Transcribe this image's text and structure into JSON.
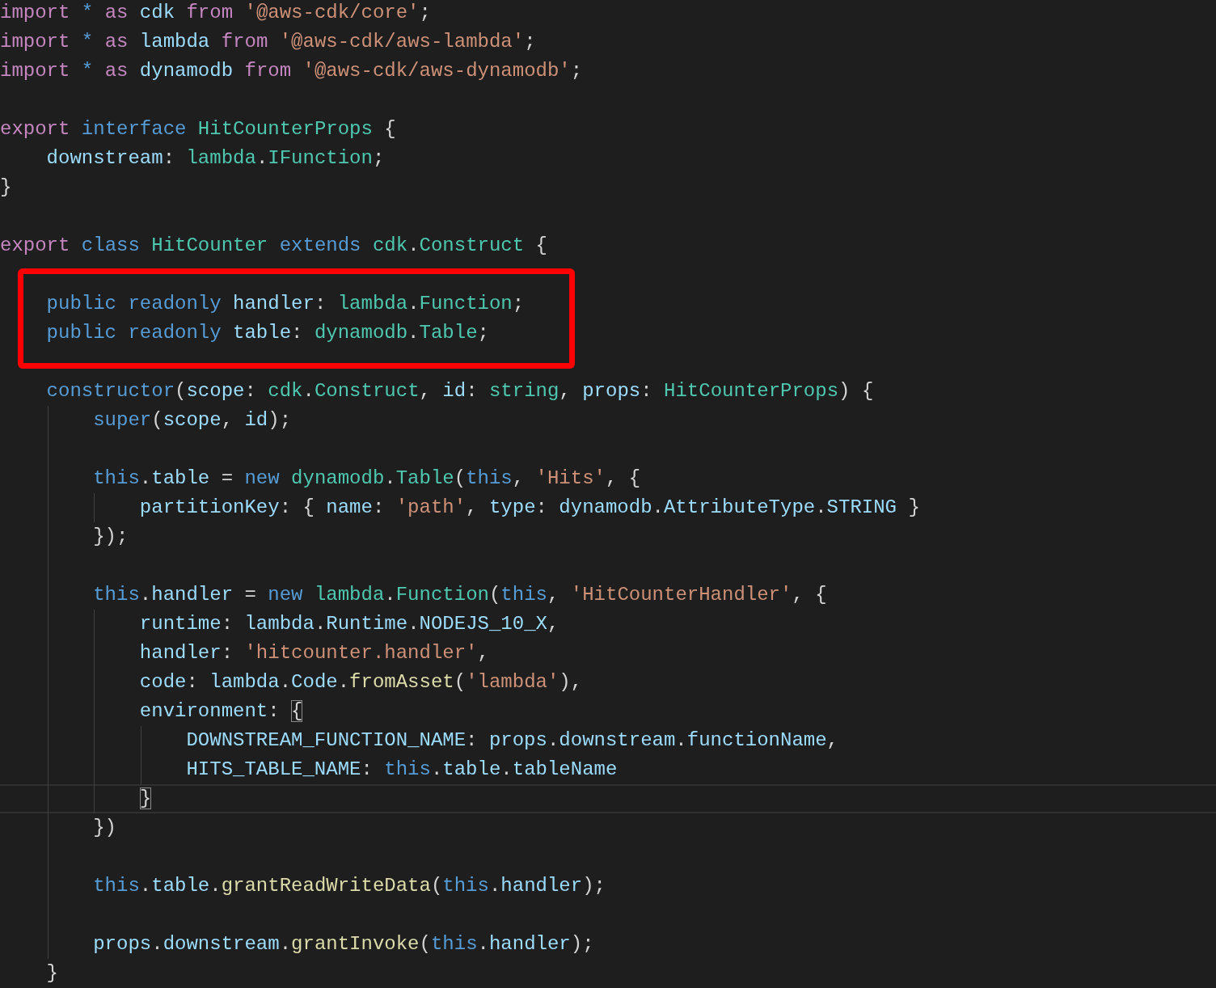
{
  "editor": {
    "lines": [
      {
        "current": false,
        "boxed": false,
        "tokens": [
          {
            "text": "import ",
            "kind": "keyword"
          },
          {
            "text": "* ",
            "kind": "storage"
          },
          {
            "text": "as ",
            "kind": "keyword"
          },
          {
            "text": "cdk ",
            "kind": "variable"
          },
          {
            "text": "from ",
            "kind": "keyword"
          },
          {
            "text": "'@aws-cdk/core'",
            "kind": "string"
          },
          {
            "text": ";",
            "kind": "punct"
          }
        ]
      },
      {
        "current": false,
        "boxed": false,
        "tokens": [
          {
            "text": "import ",
            "kind": "keyword"
          },
          {
            "text": "* ",
            "kind": "storage"
          },
          {
            "text": "as ",
            "kind": "keyword"
          },
          {
            "text": "lambda ",
            "kind": "variable"
          },
          {
            "text": "from ",
            "kind": "keyword"
          },
          {
            "text": "'@aws-cdk/aws-lambda'",
            "kind": "string"
          },
          {
            "text": ";",
            "kind": "punct"
          }
        ]
      },
      {
        "current": false,
        "boxed": false,
        "tokens": [
          {
            "text": "import ",
            "kind": "keyword"
          },
          {
            "text": "* ",
            "kind": "storage"
          },
          {
            "text": "as ",
            "kind": "keyword"
          },
          {
            "text": "dynamodb ",
            "kind": "variable"
          },
          {
            "text": "from ",
            "kind": "keyword"
          },
          {
            "text": "'@aws-cdk/aws-dynamodb'",
            "kind": "string"
          },
          {
            "text": ";",
            "kind": "punct"
          }
        ]
      },
      {
        "current": false,
        "boxed": false
      },
      {
        "current": false,
        "boxed": false,
        "tokens": [
          {
            "text": "export ",
            "kind": "keyword"
          },
          {
            "text": "interface ",
            "kind": "storage"
          },
          {
            "text": "HitCounterProps ",
            "kind": "type"
          },
          {
            "text": "{",
            "kind": "punct"
          }
        ]
      },
      {
        "current": false,
        "boxed": false,
        "tokens": [
          {
            "text": "    downstream",
            "kind": "variable"
          },
          {
            "text": ": ",
            "kind": "punct"
          },
          {
            "text": "lambda",
            "kind": "type"
          },
          {
            "text": ".",
            "kind": "punct"
          },
          {
            "text": "IFunction",
            "kind": "type"
          },
          {
            "text": ";",
            "kind": "punct"
          }
        ]
      },
      {
        "current": false,
        "boxed": false,
        "tokens": [
          {
            "text": "}",
            "kind": "punct"
          }
        ]
      },
      {
        "current": false,
        "boxed": false
      },
      {
        "current": false,
        "boxed": false,
        "tokens": [
          {
            "text": "export ",
            "kind": "keyword"
          },
          {
            "text": "class ",
            "kind": "storage"
          },
          {
            "text": "HitCounter ",
            "kind": "type"
          },
          {
            "text": "extends ",
            "kind": "storage"
          },
          {
            "text": "cdk",
            "kind": "type"
          },
          {
            "text": ".",
            "kind": "punct"
          },
          {
            "text": "Construct ",
            "kind": "type"
          },
          {
            "text": "{",
            "kind": "punct"
          }
        ]
      },
      {
        "current": false,
        "boxed": false
      },
      {
        "current": false,
        "boxed": true,
        "tokens": [
          {
            "text": "    public ",
            "kind": "storage"
          },
          {
            "text": "readonly ",
            "kind": "storage"
          },
          {
            "text": "handler",
            "kind": "variable"
          },
          {
            "text": ": ",
            "kind": "punct"
          },
          {
            "text": "lambda",
            "kind": "type"
          },
          {
            "text": ".",
            "kind": "punct"
          },
          {
            "text": "Function",
            "kind": "type"
          },
          {
            "text": ";",
            "kind": "punct"
          }
        ]
      },
      {
        "current": false,
        "boxed": true,
        "tokens": [
          {
            "text": "    public ",
            "kind": "storage"
          },
          {
            "text": "readonly ",
            "kind": "storage"
          },
          {
            "text": "table",
            "kind": "variable"
          },
          {
            "text": ": ",
            "kind": "punct"
          },
          {
            "text": "dynamodb",
            "kind": "type"
          },
          {
            "text": ".",
            "kind": "punct"
          },
          {
            "text": "Table",
            "kind": "type"
          },
          {
            "text": ";",
            "kind": "punct"
          }
        ]
      },
      {
        "current": false,
        "boxed": false
      },
      {
        "current": false,
        "boxed": false,
        "tokens": [
          {
            "text": "    constructor",
            "kind": "storage"
          },
          {
            "text": "(",
            "kind": "punct"
          },
          {
            "text": "scope",
            "kind": "variable"
          },
          {
            "text": ": ",
            "kind": "punct"
          },
          {
            "text": "cdk",
            "kind": "type"
          },
          {
            "text": ".",
            "kind": "punct"
          },
          {
            "text": "Construct",
            "kind": "type"
          },
          {
            "text": ", ",
            "kind": "punct"
          },
          {
            "text": "id",
            "kind": "variable"
          },
          {
            "text": ": ",
            "kind": "punct"
          },
          {
            "text": "string",
            "kind": "type"
          },
          {
            "text": ", ",
            "kind": "punct"
          },
          {
            "text": "props",
            "kind": "variable"
          },
          {
            "text": ": ",
            "kind": "punct"
          },
          {
            "text": "HitCounterProps",
            "kind": "type"
          },
          {
            "text": ") {",
            "kind": "punct"
          }
        ]
      },
      {
        "current": false,
        "boxed": false,
        "tokens": [
          {
            "text": "        super",
            "kind": "storage"
          },
          {
            "text": "(",
            "kind": "punct"
          },
          {
            "text": "scope",
            "kind": "variable"
          },
          {
            "text": ", ",
            "kind": "punct"
          },
          {
            "text": "id",
            "kind": "variable"
          },
          {
            "text": ");",
            "kind": "punct"
          }
        ]
      },
      {
        "current": false,
        "boxed": false
      },
      {
        "current": false,
        "boxed": false,
        "tokens": [
          {
            "text": "        this",
            "kind": "storage"
          },
          {
            "text": ".",
            "kind": "punct"
          },
          {
            "text": "table",
            "kind": "variable"
          },
          {
            "text": " = ",
            "kind": "punct"
          },
          {
            "text": "new ",
            "kind": "storage"
          },
          {
            "text": "dynamodb",
            "kind": "type"
          },
          {
            "text": ".",
            "kind": "punct"
          },
          {
            "text": "Table",
            "kind": "type"
          },
          {
            "text": "(",
            "kind": "punct"
          },
          {
            "text": "this",
            "kind": "storage"
          },
          {
            "text": ", ",
            "kind": "punct"
          },
          {
            "text": "'Hits'",
            "kind": "string"
          },
          {
            "text": ", {",
            "kind": "punct"
          }
        ]
      },
      {
        "current": false,
        "boxed": false,
        "tokens": [
          {
            "text": "            partitionKey",
            "kind": "variable"
          },
          {
            "text": ": { ",
            "kind": "punct"
          },
          {
            "text": "name",
            "kind": "variable"
          },
          {
            "text": ": ",
            "kind": "punct"
          },
          {
            "text": "'path'",
            "kind": "string"
          },
          {
            "text": ", ",
            "kind": "punct"
          },
          {
            "text": "type",
            "kind": "variable"
          },
          {
            "text": ": ",
            "kind": "punct"
          },
          {
            "text": "dynamodb",
            "kind": "variable"
          },
          {
            "text": ".",
            "kind": "punct"
          },
          {
            "text": "AttributeType",
            "kind": "variable"
          },
          {
            "text": ".",
            "kind": "punct"
          },
          {
            "text": "STRING",
            "kind": "variable"
          },
          {
            "text": " }",
            "kind": "punct"
          }
        ]
      },
      {
        "current": false,
        "boxed": false,
        "tokens": [
          {
            "text": "        });",
            "kind": "punct"
          }
        ]
      },
      {
        "current": false,
        "boxed": false
      },
      {
        "current": false,
        "boxed": false,
        "tokens": [
          {
            "text": "        this",
            "kind": "storage"
          },
          {
            "text": ".",
            "kind": "punct"
          },
          {
            "text": "handler",
            "kind": "variable"
          },
          {
            "text": " = ",
            "kind": "punct"
          },
          {
            "text": "new ",
            "kind": "storage"
          },
          {
            "text": "lambda",
            "kind": "type"
          },
          {
            "text": ".",
            "kind": "punct"
          },
          {
            "text": "Function",
            "kind": "type"
          },
          {
            "text": "(",
            "kind": "punct"
          },
          {
            "text": "this",
            "kind": "storage"
          },
          {
            "text": ", ",
            "kind": "punct"
          },
          {
            "text": "'HitCounterHandler'",
            "kind": "string"
          },
          {
            "text": ", {",
            "kind": "punct"
          }
        ]
      },
      {
        "current": false,
        "boxed": false,
        "tokens": [
          {
            "text": "            runtime",
            "kind": "variable"
          },
          {
            "text": ": ",
            "kind": "punct"
          },
          {
            "text": "lambda",
            "kind": "variable"
          },
          {
            "text": ".",
            "kind": "punct"
          },
          {
            "text": "Runtime",
            "kind": "variable"
          },
          {
            "text": ".",
            "kind": "punct"
          },
          {
            "text": "NODEJS_10_X",
            "kind": "variable"
          },
          {
            "text": ",",
            "kind": "punct"
          }
        ]
      },
      {
        "current": false,
        "boxed": false,
        "tokens": [
          {
            "text": "            handler",
            "kind": "variable"
          },
          {
            "text": ": ",
            "kind": "punct"
          },
          {
            "text": "'hitcounter.handler'",
            "kind": "string"
          },
          {
            "text": ",",
            "kind": "punct"
          }
        ]
      },
      {
        "current": false,
        "boxed": false,
        "tokens": [
          {
            "text": "            code",
            "kind": "variable"
          },
          {
            "text": ": ",
            "kind": "punct"
          },
          {
            "text": "lambda",
            "kind": "variable"
          },
          {
            "text": ".",
            "kind": "punct"
          },
          {
            "text": "Code",
            "kind": "variable"
          },
          {
            "text": ".",
            "kind": "punct"
          },
          {
            "text": "fromAsset",
            "kind": "function"
          },
          {
            "text": "(",
            "kind": "punct"
          },
          {
            "text": "'lambda'",
            "kind": "string"
          },
          {
            "text": "),",
            "kind": "punct"
          }
        ]
      },
      {
        "current": false,
        "boxed": false,
        "tokens": [
          {
            "text": "            environment",
            "kind": "variable"
          },
          {
            "text": ": ",
            "kind": "punct"
          },
          {
            "text": "{",
            "kind": "bracket_match"
          }
        ]
      },
      {
        "current": false,
        "boxed": false,
        "tokens": [
          {
            "text": "                DOWNSTREAM_FUNCTION_NAME",
            "kind": "variable"
          },
          {
            "text": ": ",
            "kind": "punct"
          },
          {
            "text": "props",
            "kind": "variable"
          },
          {
            "text": ".",
            "kind": "punct"
          },
          {
            "text": "downstream",
            "kind": "variable"
          },
          {
            "text": ".",
            "kind": "punct"
          },
          {
            "text": "functionName",
            "kind": "variable"
          },
          {
            "text": ",",
            "kind": "punct"
          }
        ]
      },
      {
        "current": false,
        "boxed": false,
        "tokens": [
          {
            "text": "                HITS_TABLE_NAME",
            "kind": "variable"
          },
          {
            "text": ": ",
            "kind": "punct"
          },
          {
            "text": "this",
            "kind": "storage"
          },
          {
            "text": ".",
            "kind": "punct"
          },
          {
            "text": "table",
            "kind": "variable"
          },
          {
            "text": ".",
            "kind": "punct"
          },
          {
            "text": "tableName",
            "kind": "variable"
          }
        ]
      },
      {
        "current": true,
        "boxed": false,
        "tokens": [
          {
            "text": "            }",
            "kind": "bracket_match"
          }
        ]
      },
      {
        "current": false,
        "boxed": false,
        "tokens": [
          {
            "text": "        })",
            "kind": "punct"
          }
        ]
      },
      {
        "current": false,
        "boxed": false
      },
      {
        "current": false,
        "boxed": false,
        "tokens": [
          {
            "text": "        this",
            "kind": "storage"
          },
          {
            "text": ".",
            "kind": "punct"
          },
          {
            "text": "table",
            "kind": "variable"
          },
          {
            "text": ".",
            "kind": "punct"
          },
          {
            "text": "grantReadWriteData",
            "kind": "function"
          },
          {
            "text": "(",
            "kind": "punct"
          },
          {
            "text": "this",
            "kind": "storage"
          },
          {
            "text": ".",
            "kind": "punct"
          },
          {
            "text": "handler",
            "kind": "variable"
          },
          {
            "text": ");",
            "kind": "punct"
          }
        ]
      },
      {
        "current": false,
        "boxed": false
      },
      {
        "current": false,
        "boxed": false,
        "tokens": [
          {
            "text": "        props",
            "kind": "variable"
          },
          {
            "text": ".",
            "kind": "punct"
          },
          {
            "text": "downstream",
            "kind": "variable"
          },
          {
            "text": ".",
            "kind": "punct"
          },
          {
            "text": "grantInvoke",
            "kind": "function"
          },
          {
            "text": "(",
            "kind": "punct"
          },
          {
            "text": "this",
            "kind": "storage"
          },
          {
            "text": ".",
            "kind": "punct"
          },
          {
            "text": "handler",
            "kind": "variable"
          },
          {
            "text": ");",
            "kind": "punct"
          }
        ]
      },
      {
        "current": false,
        "boxed": false,
        "tokens": [
          {
            "text": "    }",
            "kind": "punct"
          }
        ]
      }
    ]
  }
}
